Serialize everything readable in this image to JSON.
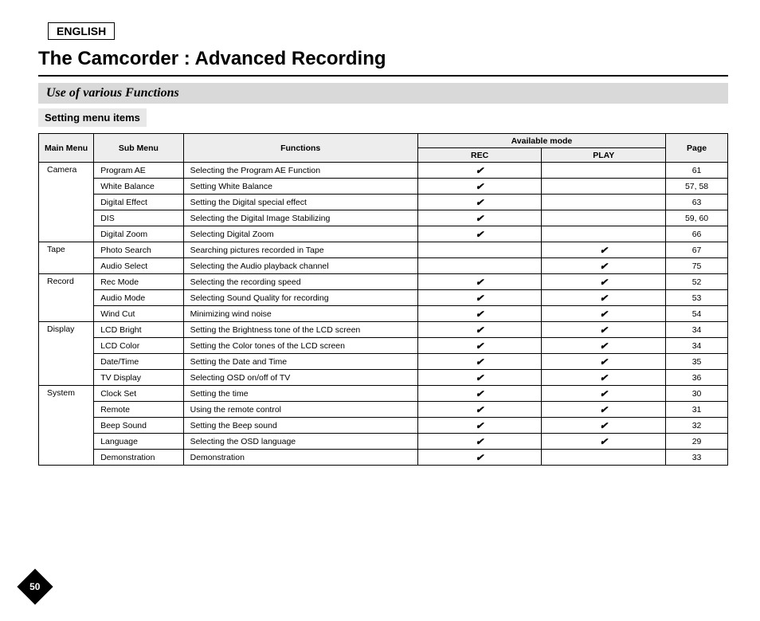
{
  "language": "ENGLISH",
  "title": "The Camcorder : Advanced Recording",
  "subheading": "Use of various Functions",
  "subheading2": "Setting menu items",
  "table": {
    "headers": {
      "main": "Main Menu",
      "sub": "Sub Menu",
      "func": "Functions",
      "modeGroup": "Available mode",
      "rec": "REC",
      "play": "PLAY",
      "page": "Page"
    },
    "groups": [
      {
        "main": "Camera",
        "rows": [
          {
            "sub": "Program AE",
            "func": "Selecting the Program AE Function",
            "rec": true,
            "play": false,
            "page": "61"
          },
          {
            "sub": "White Balance",
            "func": "Setting White Balance",
            "rec": true,
            "play": false,
            "page": "57, 58"
          },
          {
            "sub": "Digital Effect",
            "func": "Setting the Digital special effect",
            "rec": true,
            "play": false,
            "page": "63"
          },
          {
            "sub": "DIS",
            "func": "Selecting the Digital Image Stabilizing",
            "rec": true,
            "play": false,
            "page": "59, 60"
          },
          {
            "sub": "Digital Zoom",
            "func": "Selecting Digital Zoom",
            "rec": true,
            "play": false,
            "page": "66"
          }
        ]
      },
      {
        "main": "Tape",
        "rows": [
          {
            "sub": "Photo Search",
            "func": "Searching pictures recorded in Tape",
            "rec": false,
            "play": true,
            "page": "67"
          },
          {
            "sub": "Audio Select",
            "func": "Selecting the Audio playback channel",
            "rec": false,
            "play": true,
            "page": "75"
          }
        ]
      },
      {
        "main": "Record",
        "rows": [
          {
            "sub": "Rec Mode",
            "func": "Selecting the recording speed",
            "rec": true,
            "play": true,
            "page": "52"
          },
          {
            "sub": "Audio Mode",
            "func": "Selecting Sound Quality for recording",
            "rec": true,
            "play": true,
            "page": "53"
          },
          {
            "sub": "Wind Cut",
            "func": "Minimizing wind noise",
            "rec": true,
            "play": true,
            "page": "54"
          }
        ]
      },
      {
        "main": "Display",
        "rows": [
          {
            "sub": "LCD Bright",
            "func": "Setting the Brightness tone of the LCD screen",
            "rec": true,
            "play": true,
            "page": "34"
          },
          {
            "sub": "LCD Color",
            "func": "Setting the Color tones of the LCD screen",
            "rec": true,
            "play": true,
            "page": "34"
          },
          {
            "sub": "Date/Time",
            "func": "Setting the Date and Time",
            "rec": true,
            "play": true,
            "page": "35"
          },
          {
            "sub": "TV Display",
            "func": "Selecting OSD on/off of TV",
            "rec": true,
            "play": true,
            "page": "36"
          }
        ]
      },
      {
        "main": "System",
        "rows": [
          {
            "sub": "Clock Set",
            "func": "Setting the time",
            "rec": true,
            "play": true,
            "page": "30"
          },
          {
            "sub": "Remote",
            "func": "Using the remote control",
            "rec": true,
            "play": true,
            "page": "31"
          },
          {
            "sub": "Beep Sound",
            "func": "Setting the Beep sound",
            "rec": true,
            "play": true,
            "page": "32"
          },
          {
            "sub": "Language",
            "func": "Selecting the OSD language",
            "rec": true,
            "play": true,
            "page": "29"
          },
          {
            "sub": "Demonstration",
            "func": "Demonstration",
            "rec": true,
            "play": false,
            "page": "33"
          }
        ]
      }
    ]
  },
  "pageNumber": "50",
  "checkMark": "✔"
}
